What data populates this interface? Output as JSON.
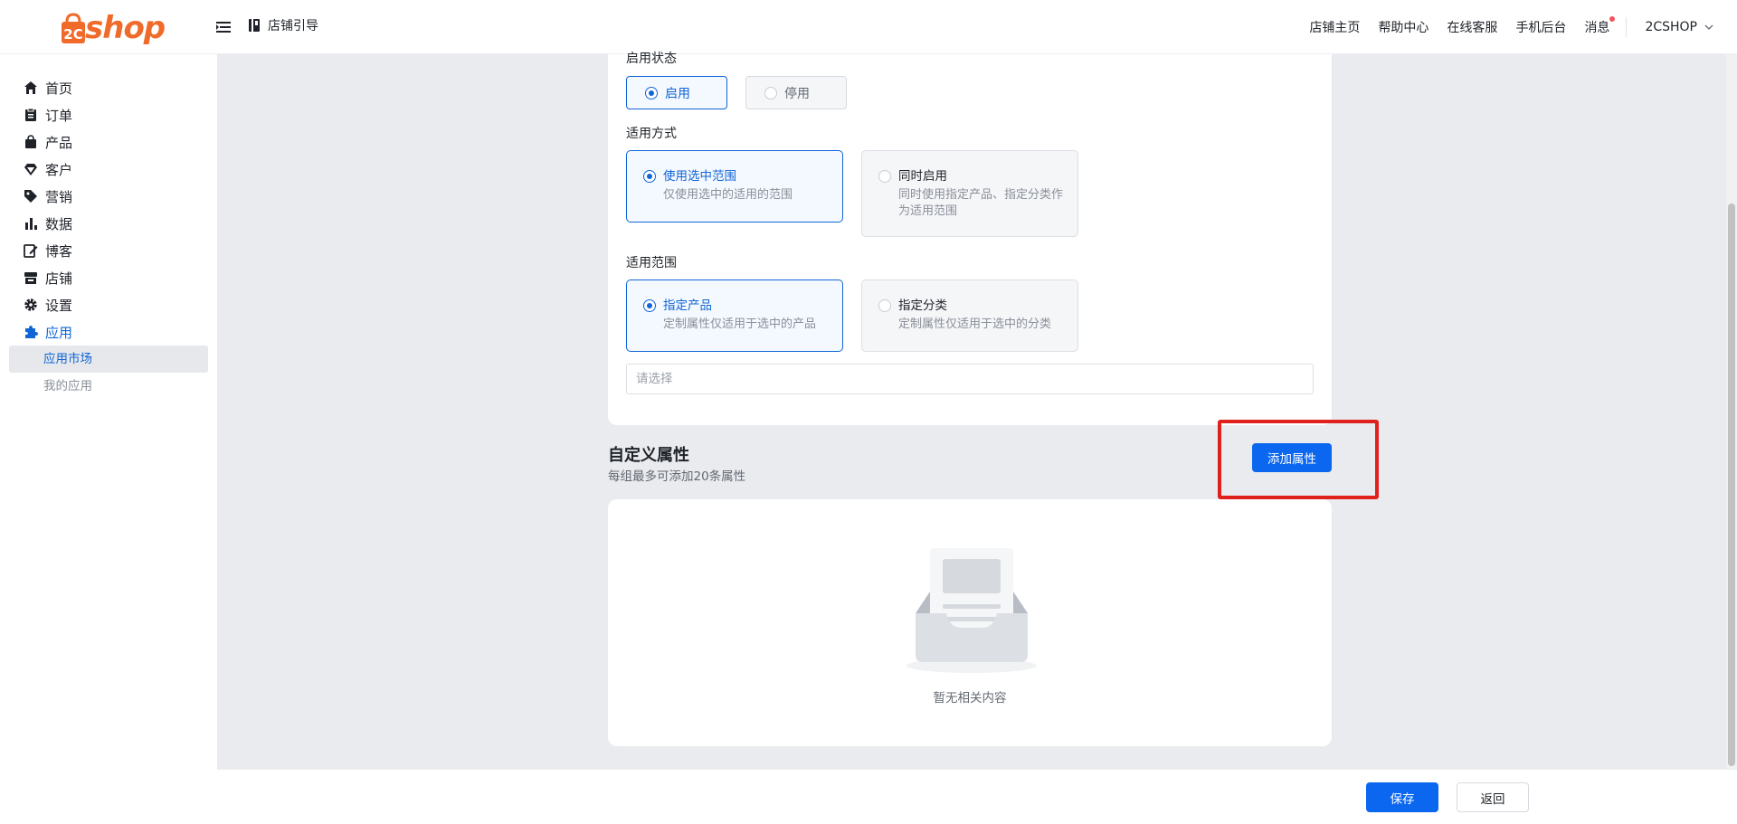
{
  "header": {
    "logo_text": "shop",
    "guide_label": "店铺引导",
    "links": [
      "店铺主页",
      "帮助中心",
      "在线客服",
      "手机后台"
    ],
    "messages_label": "消息",
    "user_name": "2CSHOP"
  },
  "sidebar": {
    "items": [
      {
        "label": "首页",
        "icon": "home-icon"
      },
      {
        "label": "订单",
        "icon": "order-icon"
      },
      {
        "label": "产品",
        "icon": "bag-icon"
      },
      {
        "label": "客户",
        "icon": "diamond-icon"
      },
      {
        "label": "营销",
        "icon": "tag-icon"
      },
      {
        "label": "数据",
        "icon": "chart-icon"
      },
      {
        "label": "博客",
        "icon": "edit-icon"
      },
      {
        "label": "店铺",
        "icon": "store-icon"
      },
      {
        "label": "设置",
        "icon": "gear-icon"
      },
      {
        "label": "应用",
        "icon": "puzzle-icon"
      }
    ],
    "sub_items": [
      {
        "label": "应用市场"
      },
      {
        "label": "我的应用"
      }
    ]
  },
  "form": {
    "status_label": "启用状态",
    "status_options": [
      "启用",
      "停用"
    ],
    "mode_label": "适用方式",
    "mode_options": [
      {
        "title": "使用选中范围",
        "desc": "仅使用选中的适用的范围"
      },
      {
        "title": "同时启用",
        "desc": "同时使用指定产品、指定分类作为适用范围"
      }
    ],
    "scope_label": "适用范围",
    "scope_options": [
      {
        "title": "指定产品",
        "desc": "定制属性仅适用于选中的产品"
      },
      {
        "title": "指定分类",
        "desc": "定制属性仅适用于选中的分类"
      }
    ],
    "select_placeholder": "请选择"
  },
  "custom_attrs": {
    "title": "自定义属性",
    "subtitle": "每组最多可添加20条属性",
    "add_label": "添加属性",
    "empty_text": "暂无相关内容"
  },
  "footer": {
    "save_label": "保存",
    "back_label": "返回"
  },
  "colors": {
    "accent": "#0b66f0",
    "brand": "#f06a2a",
    "highlight": "#e0201c"
  }
}
